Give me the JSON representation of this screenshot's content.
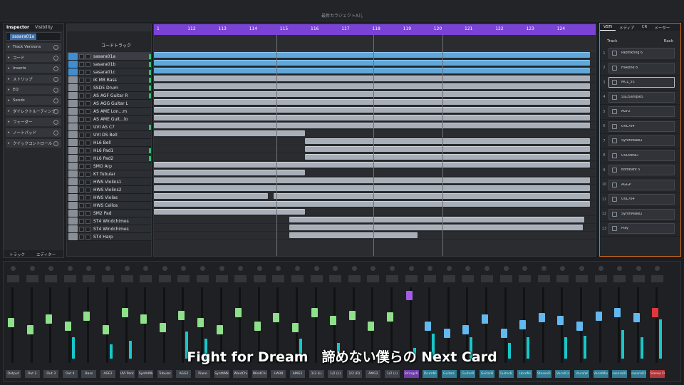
{
  "project_title": "最新カラジェクトA儿",
  "inspector": {
    "tabs": [
      "Inspector",
      "Visibility"
    ],
    "selected_track": "sasara01a",
    "sections": [
      {
        "label": "Track Versions"
      },
      {
        "label": "コード"
      },
      {
        "label": "Inserts"
      },
      {
        "label": "ストリップ"
      },
      {
        "label": "EQ"
      },
      {
        "label": "Sends"
      },
      {
        "label": "ダイレクトルーティング"
      },
      {
        "label": "フェーダー"
      },
      {
        "label": "ノートパッド"
      },
      {
        "label": "クイックコントロール"
      }
    ],
    "bottom_tabs": [
      "トラック",
      "エディター"
    ]
  },
  "tracklist": {
    "chord_track_label": "コードトラック",
    "tracks": [
      {
        "name": "sasara01a",
        "color": "#3f8fd0",
        "sel": true
      },
      {
        "name": "sasara01b",
        "color": "#3f8fd0"
      },
      {
        "name": "sasara01c",
        "color": "#3f8fd0"
      },
      {
        "name": "IK MB Bass",
        "color": "#8a8f97"
      },
      {
        "name": "SSD5 Drum",
        "color": "#8a8f97"
      },
      {
        "name": "AS AGF Guitar R",
        "color": "#8a8f97"
      },
      {
        "name": "AS AGG Guitar L",
        "color": "#8a8f97"
      },
      {
        "name": "AS AME Lon...m",
        "color": "#8a8f97"
      },
      {
        "name": "AS AME Guit...lo",
        "color": "#8a8f97"
      },
      {
        "name": "UVI AS C7",
        "color": "#8a8f97"
      },
      {
        "name": "UVI DS Bell",
        "color": "#8a8f97"
      },
      {
        "name": "HL6 Bell",
        "color": "#8a8f97"
      },
      {
        "name": "HL6 Pad1",
        "color": "#8a8f97"
      },
      {
        "name": "HL6 Pad2",
        "color": "#8a8f97"
      },
      {
        "name": "SMO Arp",
        "color": "#8a8f97"
      },
      {
        "name": "KT Tubular",
        "color": "#8a8f97"
      },
      {
        "name": "HWS Violins1",
        "color": "#8a8f97"
      },
      {
        "name": "HWS Violins2",
        "color": "#8a8f97"
      },
      {
        "name": "HWS Violas",
        "color": "#8a8f97"
      },
      {
        "name": "HWS Cellos",
        "color": "#8a8f97"
      },
      {
        "name": "SM2 Pad",
        "color": "#8a8f97"
      },
      {
        "name": "ST4 Windchimes",
        "color": "#8a8f97"
      },
      {
        "name": "ST4 Windchimes",
        "color": "#8a8f97"
      },
      {
        "name": "ST4 Harp",
        "color": "#8a8f97"
      }
    ]
  },
  "ruler": {
    "bars": [
      "1",
      "112",
      "113",
      "114",
      "115",
      "116",
      "117",
      "118",
      "119",
      "120",
      "121",
      "122",
      "123",
      "124"
    ]
  },
  "vsti": {
    "tabs": [
      "VSTi",
      "メディア",
      "CR",
      "メーター"
    ],
    "header_track": "Track",
    "header_rack": "Rack",
    "slots": [
      {
        "num": "1",
        "name": "Padmkting 6"
      },
      {
        "num": "2",
        "name": "HiAlone 8"
      },
      {
        "num": "3",
        "name": "MCL_55",
        "sel": true
      },
      {
        "num": "4",
        "name": "SSD5ample5"
      },
      {
        "num": "5",
        "name": "AGF2"
      },
      {
        "num": "6",
        "name": "UVL764"
      },
      {
        "num": "7",
        "name": "SynthMake2"
      },
      {
        "num": "8",
        "name": "UVLMkNO"
      },
      {
        "num": "9",
        "name": "Bombaht 5"
      },
      {
        "num": "10",
        "name": "AGGP"
      },
      {
        "num": "11",
        "name": "UVL764"
      },
      {
        "num": "12",
        "name": "SynthMake2"
      },
      {
        "num": "13",
        "name": "Play"
      }
    ]
  },
  "mixer": {
    "channels": [
      {
        "name": "Output",
        "fader": "green",
        "level": 0.55,
        "meter": 0.0
      },
      {
        "name": "Out 2",
        "fader": "green",
        "level": 0.45,
        "meter": 0.0
      },
      {
        "name": "Out 3",
        "fader": "green",
        "level": 0.6,
        "meter": 0.0
      },
      {
        "name": "Out 4",
        "fader": "green",
        "level": 0.5,
        "meter": 0.3
      },
      {
        "name": "Bass",
        "fader": "green",
        "level": 0.65,
        "meter": 0.0
      },
      {
        "name": "AGF2",
        "fader": "green",
        "level": 0.45,
        "meter": 0.2
      },
      {
        "name": "UVI Perk",
        "fader": "green",
        "level": 0.7,
        "meter": 0.25
      },
      {
        "name": "SynthMk",
        "fader": "green",
        "level": 0.6,
        "meter": 0.0
      },
      {
        "name": "Tubular",
        "fader": "green",
        "level": 0.48,
        "meter": 0.0
      },
      {
        "name": "AGG2",
        "fader": "green",
        "level": 0.66,
        "meter": 0.38
      },
      {
        "name": "Piano",
        "fader": "green",
        "level": 0.55,
        "meter": 0.28
      },
      {
        "name": "SynthMk",
        "fader": "green",
        "level": 0.45,
        "meter": 0.0
      },
      {
        "name": "WindChi",
        "fader": "green",
        "level": 0.7,
        "meter": 0.0
      },
      {
        "name": "WindChi",
        "fader": "green",
        "level": 0.5,
        "meter": 0.0
      },
      {
        "name": "HAR8",
        "fader": "green",
        "level": 0.62,
        "meter": 0.0
      },
      {
        "name": "AMG2",
        "fader": "green",
        "level": 0.48,
        "meter": 0.28
      },
      {
        "name": "1/2 (L)",
        "fader": "green",
        "level": 0.7,
        "meter": 0.0
      },
      {
        "name": "1/2 (L)",
        "fader": "green",
        "level": 0.58,
        "meter": 0.22
      },
      {
        "name": "1/2 (R)",
        "fader": "green",
        "level": 0.66,
        "meter": 0.0
      },
      {
        "name": "AMG2",
        "fader": "green",
        "level": 0.5,
        "meter": 0.0
      },
      {
        "name": "1/2 (L)",
        "fader": "green",
        "level": 0.64,
        "meter": 0.0
      },
      {
        "name": "StringsR",
        "fader": "purple",
        "level": 0.95,
        "meter": 0.15
      },
      {
        "name": "DrumMi",
        "fader": "blue",
        "level": 0.5,
        "meter": 0.35
      },
      {
        "name": "GuitarL",
        "fader": "blue",
        "level": 0.4,
        "meter": 0.0
      },
      {
        "name": "GuitarR",
        "fader": "blue",
        "level": 0.45,
        "meter": 0.3
      },
      {
        "name": "GuitarB",
        "fader": "blue",
        "level": 0.6,
        "meter": 0.0
      },
      {
        "name": "GuitarB",
        "fader": "blue",
        "level": 0.4,
        "meter": 0.22
      },
      {
        "name": "HornMi",
        "fader": "blue",
        "level": 0.52,
        "meter": 0.3
      },
      {
        "name": "StereoO",
        "fader": "blue",
        "level": 0.62,
        "meter": 0.0
      },
      {
        "name": "VocalCa",
        "fader": "blue",
        "level": 0.58,
        "meter": 0.3
      },
      {
        "name": "VocalW",
        "fader": "blue",
        "level": 0.5,
        "meter": 0.32
      },
      {
        "name": "VocalMix",
        "fader": "blue",
        "level": 0.65,
        "meter": 0.0
      },
      {
        "name": "sasara01",
        "fader": "blue",
        "level": 0.7,
        "meter": 0.4
      },
      {
        "name": "sasara01",
        "fader": "blue",
        "level": 0.62,
        "meter": 0.3
      },
      {
        "name": "Stereo O",
        "fader": "red",
        "level": 0.7,
        "meter": 0.55
      }
    ]
  },
  "subtitle": "Fight for Dream　諦めない僕らの Next Card",
  "colors": {
    "accent": "#7b42d6",
    "selection": "#3c6fa8",
    "vsti_border": "#d06a1e",
    "meter": "#18c7c9"
  }
}
